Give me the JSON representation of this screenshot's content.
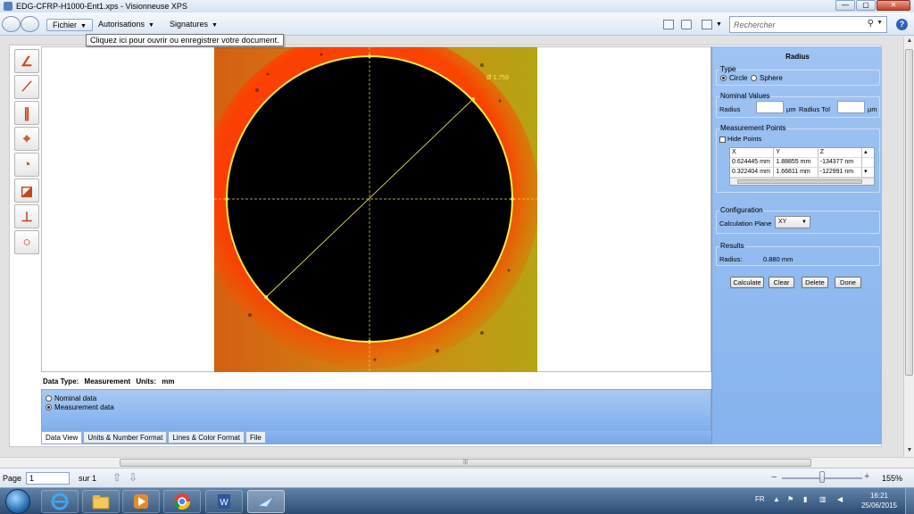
{
  "window": {
    "title": "EDG-CFRP-H1000-Ent1.xps - Visionneuse XPS",
    "minimize": "—",
    "maximize": "▢",
    "close": "✕"
  },
  "menu": {
    "fichier": "Fichier",
    "autorisations": "Autorisations",
    "signatures": "Signatures",
    "tooltip": "Cliquez ici pour ouvrir ou enregistrer votre document."
  },
  "search": {
    "placeholder": "Rechercher"
  },
  "plot": {
    "diameter_label": "Ø 1.759"
  },
  "data_panel": {
    "data_type_label": "Data Type:",
    "data_type_value": "Measurement",
    "units_label": "Units:",
    "units_value": "mm",
    "options": [
      {
        "label": "Nominal data",
        "selected": false
      },
      {
        "label": "Measurement data",
        "selected": true
      }
    ],
    "tabs": [
      "Data View",
      "Units & Number Format",
      "Lines & Color Format",
      "File"
    ]
  },
  "right_panel": {
    "title": "Radius",
    "type_group": "Type",
    "type_circle": "Circle",
    "type_sphere": "Sphere",
    "nominal_group": "Nominal Values",
    "radius_label": "Radius",
    "radius_unit": "µm",
    "radius_tol_label": "Radius Tol",
    "radius_tol_unit": "µm",
    "measurement_group": "Measurement Points",
    "hide_points": "Hide Points",
    "table": {
      "headers": [
        "X",
        "Y",
        "Z"
      ],
      "rows": [
        [
          "0.624445 mm",
          "1.88855 mm",
          "-134377 nm"
        ],
        [
          "0.322404 mm",
          "1.66811 mm",
          "-122991 nm"
        ]
      ]
    },
    "config_group": "Configuration",
    "calc_plane_label": "Calculation Plane",
    "calc_plane_value": "XY",
    "results_group": "Results",
    "result_label": "Radius:",
    "result_value": "0.880 mm",
    "buttons": {
      "calculate": "Calculate",
      "clear": "Clear",
      "delete": "Delete",
      "done": "Done"
    }
  },
  "status": {
    "page_label": "Page",
    "page_value": "1",
    "of_label": "sur 1",
    "zoom": "155%"
  },
  "taskbar": {
    "language": "FR",
    "time": "16:21",
    "date": "25/06/2015"
  },
  "colors": {
    "accent_panel": "#86b3ee",
    "circle_fit": "#f2e84a",
    "tool_icon": "#c4461c"
  }
}
